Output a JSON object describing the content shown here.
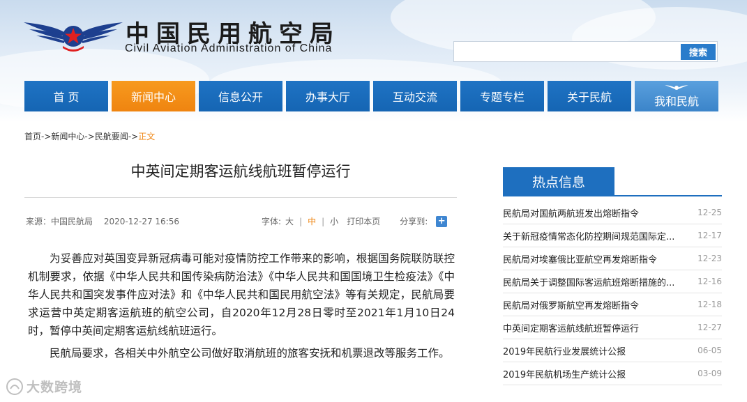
{
  "header": {
    "logo_cn": "中国民用航空局",
    "logo_en": "Civil Aviation Administration of China",
    "search": {
      "placeholder": "",
      "button_label": "搜索"
    }
  },
  "nav": {
    "items": [
      {
        "label": "首 页"
      },
      {
        "label": "新闻中心",
        "active": true
      },
      {
        "label": "信息公开"
      },
      {
        "label": "办事大厅"
      },
      {
        "label": "互动交流"
      },
      {
        "label": "专题专栏"
      },
      {
        "label": "关于民航"
      },
      {
        "label": "我和民航"
      }
    ]
  },
  "breadcrumb": {
    "home": "首页",
    "news": "新闻中心",
    "section": "民航要闻",
    "current": "正文",
    "sep": "->"
  },
  "article": {
    "title": "中英间定期客运航线航班暂停运行",
    "source": "来源：中国民航局",
    "date": "2020-12-27 16:56",
    "font_size_label": "字体:",
    "font_large": "大",
    "font_medium": "中",
    "font_small": "小",
    "print": "打印本页",
    "share": "分享到:",
    "paragraphs": [
      "为妥善应对英国变异新冠病毒可能对疫情防控工作带来的影响，根据国务院联防联控机制要求，依据《中华人民共和国传染病防治法》《中华人民共和国国境卫生检疫法》《中华人民共和国突发事件应对法》和《中华人民共和国民用航空法》等有关规定，民航局要求运营中英定期客运航班的航空公司，自2020年12月28日零时至2021年1月10日24时，暂停中英间定期客运航线航班运行。",
      "民航局要求，各相关中外航空公司做好取消航班的旅客安抚和机票退改等服务工作。"
    ]
  },
  "sidebar": {
    "title": "热点信息",
    "items": [
      {
        "title": "民航局对国航两航班发出熔断指令",
        "date": "12-25"
      },
      {
        "title": "关于新冠疫情常态化防控期间规范国际定...",
        "date": "12-17"
      },
      {
        "title": "民航局对埃塞俄比亚航空再发熔断指令",
        "date": "12-23"
      },
      {
        "title": "民航局关于调整国际客运航班熔断措施的...",
        "date": "12-16"
      },
      {
        "title": "民航局对俄罗斯航空再发熔断指令",
        "date": "12-18"
      },
      {
        "title": "中英间定期客运航线航班暂停运行",
        "date": "12-27"
      },
      {
        "title": "2019年民航行业发展统计公报",
        "date": "06-05"
      },
      {
        "title": "2019年民航机场生产统计公报",
        "date": "03-09"
      }
    ]
  },
  "watermark": {
    "text": "大数跨境"
  },
  "colors": {
    "nav_blue": "#1565b3",
    "nav_active": "#ef8410",
    "hot_blue": "#1e6fbf",
    "accent_orange": "#ef8410"
  }
}
